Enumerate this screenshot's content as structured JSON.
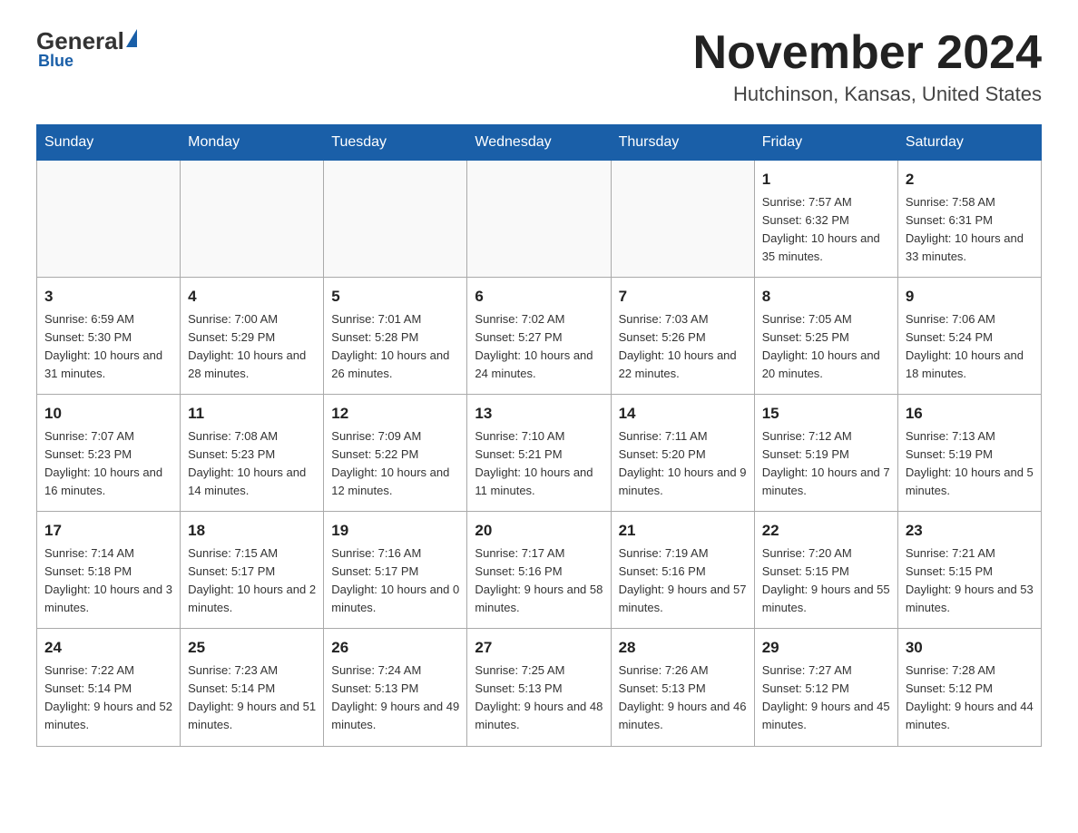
{
  "header": {
    "logo_text": "General",
    "logo_blue": "Blue",
    "month": "November 2024",
    "location": "Hutchinson, Kansas, United States"
  },
  "weekdays": [
    "Sunday",
    "Monday",
    "Tuesday",
    "Wednesday",
    "Thursday",
    "Friday",
    "Saturday"
  ],
  "weeks": [
    [
      {
        "day": "",
        "info": ""
      },
      {
        "day": "",
        "info": ""
      },
      {
        "day": "",
        "info": ""
      },
      {
        "day": "",
        "info": ""
      },
      {
        "day": "",
        "info": ""
      },
      {
        "day": "1",
        "info": "Sunrise: 7:57 AM\nSunset: 6:32 PM\nDaylight: 10 hours\nand 35 minutes."
      },
      {
        "day": "2",
        "info": "Sunrise: 7:58 AM\nSunset: 6:31 PM\nDaylight: 10 hours\nand 33 minutes."
      }
    ],
    [
      {
        "day": "3",
        "info": "Sunrise: 6:59 AM\nSunset: 5:30 PM\nDaylight: 10 hours\nand 31 minutes."
      },
      {
        "day": "4",
        "info": "Sunrise: 7:00 AM\nSunset: 5:29 PM\nDaylight: 10 hours\nand 28 minutes."
      },
      {
        "day": "5",
        "info": "Sunrise: 7:01 AM\nSunset: 5:28 PM\nDaylight: 10 hours\nand 26 minutes."
      },
      {
        "day": "6",
        "info": "Sunrise: 7:02 AM\nSunset: 5:27 PM\nDaylight: 10 hours\nand 24 minutes."
      },
      {
        "day": "7",
        "info": "Sunrise: 7:03 AM\nSunset: 5:26 PM\nDaylight: 10 hours\nand 22 minutes."
      },
      {
        "day": "8",
        "info": "Sunrise: 7:05 AM\nSunset: 5:25 PM\nDaylight: 10 hours\nand 20 minutes."
      },
      {
        "day": "9",
        "info": "Sunrise: 7:06 AM\nSunset: 5:24 PM\nDaylight: 10 hours\nand 18 minutes."
      }
    ],
    [
      {
        "day": "10",
        "info": "Sunrise: 7:07 AM\nSunset: 5:23 PM\nDaylight: 10 hours\nand 16 minutes."
      },
      {
        "day": "11",
        "info": "Sunrise: 7:08 AM\nSunset: 5:23 PM\nDaylight: 10 hours\nand 14 minutes."
      },
      {
        "day": "12",
        "info": "Sunrise: 7:09 AM\nSunset: 5:22 PM\nDaylight: 10 hours\nand 12 minutes."
      },
      {
        "day": "13",
        "info": "Sunrise: 7:10 AM\nSunset: 5:21 PM\nDaylight: 10 hours\nand 11 minutes."
      },
      {
        "day": "14",
        "info": "Sunrise: 7:11 AM\nSunset: 5:20 PM\nDaylight: 10 hours\nand 9 minutes."
      },
      {
        "day": "15",
        "info": "Sunrise: 7:12 AM\nSunset: 5:19 PM\nDaylight: 10 hours\nand 7 minutes."
      },
      {
        "day": "16",
        "info": "Sunrise: 7:13 AM\nSunset: 5:19 PM\nDaylight: 10 hours\nand 5 minutes."
      }
    ],
    [
      {
        "day": "17",
        "info": "Sunrise: 7:14 AM\nSunset: 5:18 PM\nDaylight: 10 hours\nand 3 minutes."
      },
      {
        "day": "18",
        "info": "Sunrise: 7:15 AM\nSunset: 5:17 PM\nDaylight: 10 hours\nand 2 minutes."
      },
      {
        "day": "19",
        "info": "Sunrise: 7:16 AM\nSunset: 5:17 PM\nDaylight: 10 hours\nand 0 minutes."
      },
      {
        "day": "20",
        "info": "Sunrise: 7:17 AM\nSunset: 5:16 PM\nDaylight: 9 hours\nand 58 minutes."
      },
      {
        "day": "21",
        "info": "Sunrise: 7:19 AM\nSunset: 5:16 PM\nDaylight: 9 hours\nand 57 minutes."
      },
      {
        "day": "22",
        "info": "Sunrise: 7:20 AM\nSunset: 5:15 PM\nDaylight: 9 hours\nand 55 minutes."
      },
      {
        "day": "23",
        "info": "Sunrise: 7:21 AM\nSunset: 5:15 PM\nDaylight: 9 hours\nand 53 minutes."
      }
    ],
    [
      {
        "day": "24",
        "info": "Sunrise: 7:22 AM\nSunset: 5:14 PM\nDaylight: 9 hours\nand 52 minutes."
      },
      {
        "day": "25",
        "info": "Sunrise: 7:23 AM\nSunset: 5:14 PM\nDaylight: 9 hours\nand 51 minutes."
      },
      {
        "day": "26",
        "info": "Sunrise: 7:24 AM\nSunset: 5:13 PM\nDaylight: 9 hours\nand 49 minutes."
      },
      {
        "day": "27",
        "info": "Sunrise: 7:25 AM\nSunset: 5:13 PM\nDaylight: 9 hours\nand 48 minutes."
      },
      {
        "day": "28",
        "info": "Sunrise: 7:26 AM\nSunset: 5:13 PM\nDaylight: 9 hours\nand 46 minutes."
      },
      {
        "day": "29",
        "info": "Sunrise: 7:27 AM\nSunset: 5:12 PM\nDaylight: 9 hours\nand 45 minutes."
      },
      {
        "day": "30",
        "info": "Sunrise: 7:28 AM\nSunset: 5:12 PM\nDaylight: 9 hours\nand 44 minutes."
      }
    ]
  ]
}
